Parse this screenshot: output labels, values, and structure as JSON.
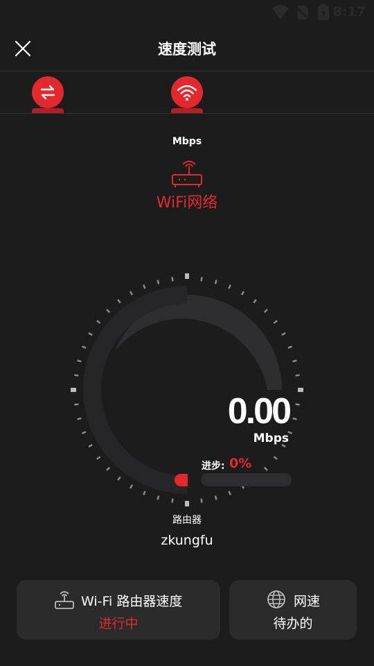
{
  "status_bar": {
    "time": "8:17",
    "icons": [
      "wifi-icon",
      "no-sim-icon",
      "battery-icon"
    ]
  },
  "header": {
    "title": "速度测试",
    "close_icon": "close-icon"
  },
  "tabs": [
    {
      "icon": "transfer-icon",
      "selected": false
    },
    {
      "icon": "wifi-icon",
      "selected": true
    }
  ],
  "test": {
    "unit_top": "Mbps",
    "mode_icon": "router-icon",
    "mode_label": "WiFi网络",
    "speed": "0.00",
    "speed_unit": "Mbps",
    "progress_label": "进步:",
    "progress_value": "0%",
    "progress": 0
  },
  "server": {
    "label": "路由器",
    "name": "zkungfu"
  },
  "cards": [
    {
      "icon": "router-icon",
      "title": "Wi-Fi 路由器速度",
      "status": "进行中"
    },
    {
      "icon": "globe-icon",
      "title": "网速",
      "status": "待办的"
    }
  ],
  "colors": {
    "accent": "#e3282e",
    "background": "#1c1c1d",
    "card": "#2b2b2c"
  }
}
